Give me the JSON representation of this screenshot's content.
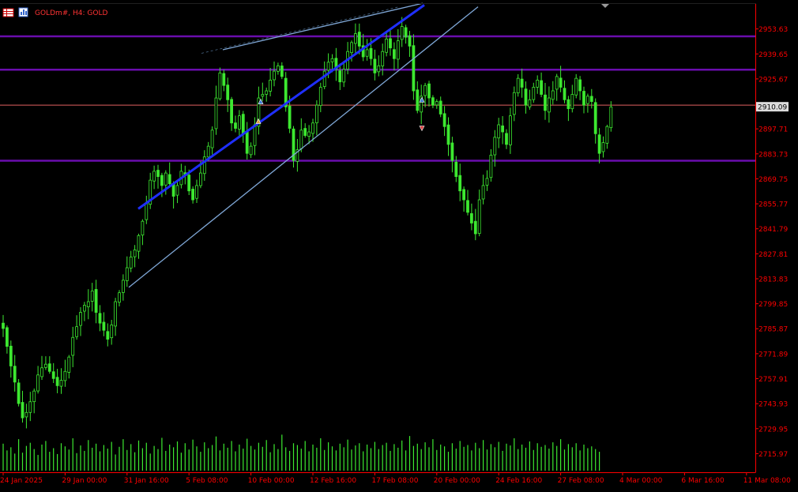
{
  "header": {
    "symbol_label": "GOLDm#, H4:  GOLD"
  },
  "colors": {
    "background": "#000000",
    "candle": "#3de830",
    "volume": "#3de830",
    "axis": "#ff0000",
    "axis_text": "#ff0000",
    "support_resistance": "#6a0dad",
    "current_price_line": "#e06060",
    "channel_line": "#7fa7d6",
    "trend_line": "#1f2fff",
    "badge_bg": "#dcdcdc",
    "badge_text": "#000000"
  },
  "chart_data": {
    "type": "candlestick",
    "title": "GOLDm#, H4:  GOLD",
    "timeframe": "H4",
    "price_axis": {
      "min": 2705.99,
      "max": 2967.61,
      "ticks": [
        2953.63,
        2939.65,
        2925.67,
        2911.69,
        2897.71,
        2883.73,
        2869.75,
        2855.77,
        2841.79,
        2827.81,
        2813.83,
        2799.85,
        2785.87,
        2771.89,
        2757.91,
        2743.93,
        2729.95,
        2715.97
      ],
      "tick_labels": [
        "2953.63",
        "2939.65",
        "2925.67",
        "",
        "2897.71",
        "2883.73",
        "2869.75",
        "2855.77",
        "2841.79",
        "2827.81",
        "2813.83",
        "2799.85",
        "2785.87",
        "2771.89",
        "2757.91",
        "2743.93",
        "2729.95",
        "2715.97"
      ],
      "current_price": 2910.09,
      "current_price_label": "2910.09"
    },
    "time_axis": {
      "labels": [
        "24 Jan 2025",
        "29 Jan 00:00",
        "31 Jan 16:00",
        "5 Feb 08:00",
        "10 Feb 00:00",
        "12 Feb 16:00",
        "17 Feb 08:00",
        "20 Feb 00:00",
        "24 Feb 16:00",
        "27 Feb 08:00",
        "4 Mar 00:00",
        "6 Mar 16:00",
        "11 Mar 08:00"
      ],
      "label_bar_index": [
        0,
        16,
        32,
        48,
        64,
        80,
        96,
        112,
        128,
        144,
        160,
        176,
        192
      ]
    },
    "horizontal_levels": [
      2949.5,
      2930.8,
      2911.0,
      2879.9
    ],
    "closes": [
      2786,
      2776,
      2765,
      2756,
      2744,
      2736,
      2739,
      2745,
      2751,
      2760,
      2764,
      2766,
      2762,
      2758,
      2754,
      2757,
      2762,
      2770,
      2781,
      2787,
      2795,
      2799,
      2801,
      2807,
      2795,
      2789,
      2785,
      2780,
      2788,
      2801,
      2806,
      2813,
      2820,
      2826,
      2830,
      2838,
      2846,
      2856,
      2869,
      2874,
      2871,
      2866,
      2873,
      2867,
      2860,
      2866,
      2874,
      2872,
      2863,
      2858,
      2866,
      2873,
      2882,
      2888,
      2897,
      2915,
      2929,
      2922,
      2914,
      2901,
      2898,
      2905,
      2895,
      2884,
      2888,
      2900,
      2915,
      2917,
      2919,
      2925,
      2930,
      2933,
      2927,
      2910,
      2898,
      2880,
      2886,
      2897,
      2894,
      2896,
      2901,
      2911,
      2921,
      2930,
      2935,
      2937,
      2931,
      2924,
      2931,
      2941,
      2946,
      2951,
      2944,
      2938,
      2942,
      2937,
      2929,
      2933,
      2941,
      2948,
      2943,
      2937,
      2947,
      2955,
      2949,
      2944,
      2919,
      2908,
      2916,
      2922,
      2915,
      2911,
      2913,
      2906,
      2899,
      2889,
      2880,
      2871,
      2863,
      2858,
      2851,
      2845,
      2839,
      2858,
      2866,
      2870,
      2883,
      2893,
      2900,
      2896,
      2889,
      2905,
      2918,
      2926,
      2921,
      2911,
      2914,
      2921,
      2925,
      2917,
      2908,
      2915,
      2919,
      2927,
      2921,
      2914,
      2909,
      2917,
      2926,
      2919,
      2911,
      2916,
      2913,
      2895,
      2884,
      2890,
      2899,
      2910
    ],
    "volume_scale_max": 100,
    "volumes": [
      60,
      45,
      52,
      38,
      70,
      40,
      55,
      62,
      48,
      35,
      58,
      66,
      42,
      50,
      37,
      61,
      54,
      47,
      72,
      39,
      56,
      44,
      68,
      51,
      60,
      43,
      57,
      49,
      64,
      36,
      53,
      70,
      46,
      59,
      41,
      67,
      50,
      62,
      38,
      55,
      48,
      73,
      44,
      58,
      52,
      65,
      40,
      61,
      47,
      69,
      54,
      42,
      63,
      50,
      57,
      76,
      45,
      60,
      51,
      66,
      43,
      58,
      49,
      71,
      55,
      47,
      62,
      53,
      68,
      41,
      59,
      48,
      80,
      52,
      44,
      61,
      57,
      49,
      66,
      43,
      58,
      51,
      72,
      46,
      63,
      54,
      45,
      60,
      52,
      69,
      47,
      56,
      61,
      43,
      58,
      50,
      64,
      48,
      57,
      62,
      44,
      59,
      51,
      67,
      45,
      77,
      55,
      60,
      48,
      63,
      52,
      70,
      46,
      58,
      54,
      42,
      61,
      49,
      66,
      53,
      57,
      45,
      62,
      50,
      68,
      47,
      59,
      52,
      64,
      44,
      60,
      56,
      72,
      48,
      58,
      51,
      65,
      46,
      61,
      53,
      57,
      49,
      63,
      55,
      70,
      47,
      59,
      52,
      61,
      45,
      58,
      50,
      54,
      48,
      42
    ]
  }
}
